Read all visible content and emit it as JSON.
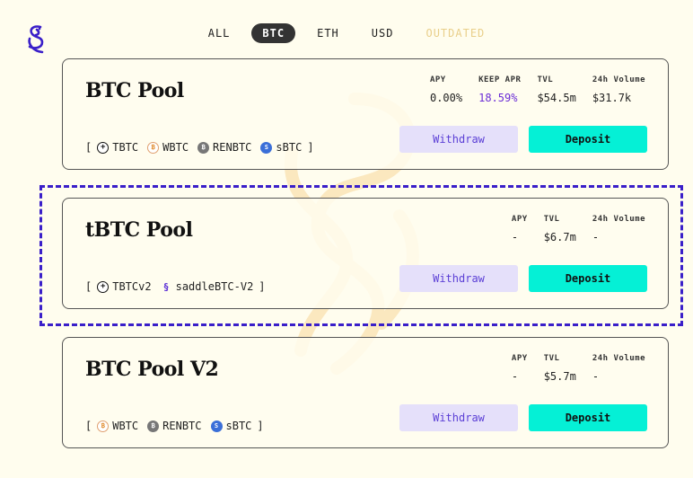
{
  "tabs": [
    {
      "label": "ALL"
    },
    {
      "label": "BTC"
    },
    {
      "label": "ETH"
    },
    {
      "label": "USD"
    },
    {
      "label": "OUTDATED"
    }
  ],
  "active_tab": "BTC",
  "colors": {
    "accent": "#6b2dd6",
    "deposit": "#05f0d6",
    "withdraw": "#e5e0fa",
    "highlight": "#3a1fc9"
  },
  "pools": [
    {
      "title": "BTC Pool",
      "stats": [
        {
          "label": "APY",
          "value": "0.00%"
        },
        {
          "label": "KEEP APR",
          "value": "18.59%"
        },
        {
          "label": "TVL",
          "value": "$54.5m"
        },
        {
          "label": "24h Volume",
          "value": "$31.7k"
        }
      ],
      "tokens": [
        {
          "icon": "tbtc-icon",
          "label": "TBTC"
        },
        {
          "icon": "wbtc-icon",
          "label": "WBTC"
        },
        {
          "icon": "renbtc-icon",
          "label": "RENBTC"
        },
        {
          "icon": "sbtc-icon",
          "label": "sBTC"
        }
      ],
      "withdraw": "Withdraw",
      "deposit": "Deposit"
    },
    {
      "title": "tBTC Pool",
      "stats": [
        {
          "label": "APY",
          "value": "-"
        },
        {
          "label": "TVL",
          "value": "$6.7m"
        },
        {
          "label": "24h Volume",
          "value": "-"
        }
      ],
      "tokens": [
        {
          "icon": "tbtc-icon",
          "label": "TBTCv2"
        },
        {
          "icon": "saddle-icon",
          "label": "saddleBTC-V2"
        }
      ],
      "withdraw": "Withdraw",
      "deposit": "Deposit"
    },
    {
      "title": "BTC Pool V2",
      "stats": [
        {
          "label": "APY",
          "value": "-"
        },
        {
          "label": "TVL",
          "value": "$5.7m"
        },
        {
          "label": "24h Volume",
          "value": "-"
        }
      ],
      "tokens": [
        {
          "icon": "wbtc-icon",
          "label": "WBTC"
        },
        {
          "icon": "renbtc-icon",
          "label": "RENBTC"
        },
        {
          "icon": "sbtc-icon",
          "label": "sBTC"
        }
      ],
      "withdraw": "Withdraw",
      "deposit": "Deposit"
    }
  ],
  "brackets": {
    "open": "[",
    "close": "]"
  }
}
